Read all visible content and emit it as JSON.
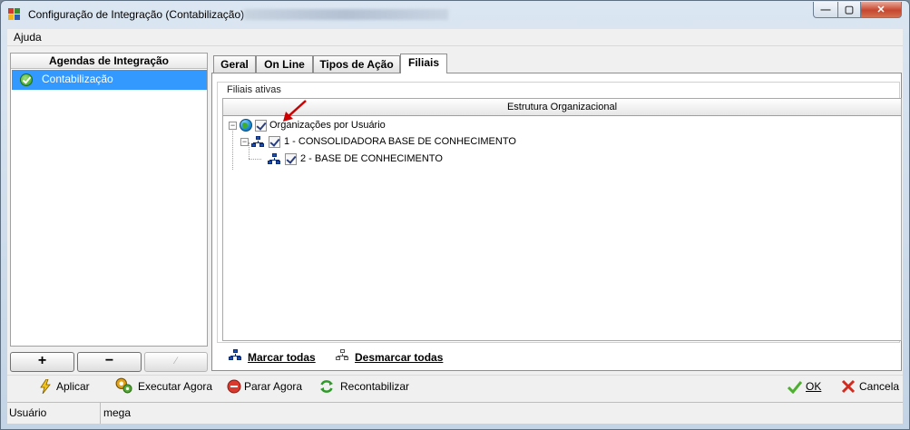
{
  "window": {
    "title": "Configuração de Integração (Contabilização)",
    "min_symbol": "—",
    "max_symbol": "▢",
    "close_symbol": "✕"
  },
  "menu": {
    "items": [
      {
        "label": "Ajuda"
      }
    ]
  },
  "left_panel": {
    "header": "Agendas de Integração",
    "items": [
      {
        "label": "Contabilização",
        "selected": true,
        "icon": "check-circle-icon"
      }
    ],
    "buttons": {
      "add": "+",
      "remove": "−",
      "edit": "⁄"
    }
  },
  "tabs": [
    {
      "label": "Geral",
      "active": false
    },
    {
      "label": "On Line",
      "active": false
    },
    {
      "label": "Tipos de Ação",
      "active": false
    },
    {
      "label": "Filiais",
      "active": true
    }
  ],
  "filiais": {
    "legend": "Filiais ativas",
    "column_header": "Estrutura Organizacional",
    "tree": [
      {
        "label": "Organizações por Usuário",
        "checked": true,
        "icon": "globe-icon"
      },
      {
        "label": "1 - CONSOLIDADORA BASE DE CONHECIMENTO",
        "checked": true,
        "icon": "org-chart-icon"
      },
      {
        "label": "2 - BASE DE CONHECIMENTO",
        "checked": true,
        "icon": "org-chart-icon"
      }
    ],
    "mark_all": "Marcar todas",
    "unmark_all": "Desmarcar todas"
  },
  "actions": {
    "apply": "Aplicar",
    "run_now": "Executar Agora",
    "stop_now": "Parar Agora",
    "recount": "Recontabilizar",
    "ok": "OK",
    "cancel": "Cancela"
  },
  "status": {
    "label": "Usuário",
    "value": "mega"
  },
  "colors": {
    "selection": "#3399ff",
    "arrow": "#cc0000"
  }
}
